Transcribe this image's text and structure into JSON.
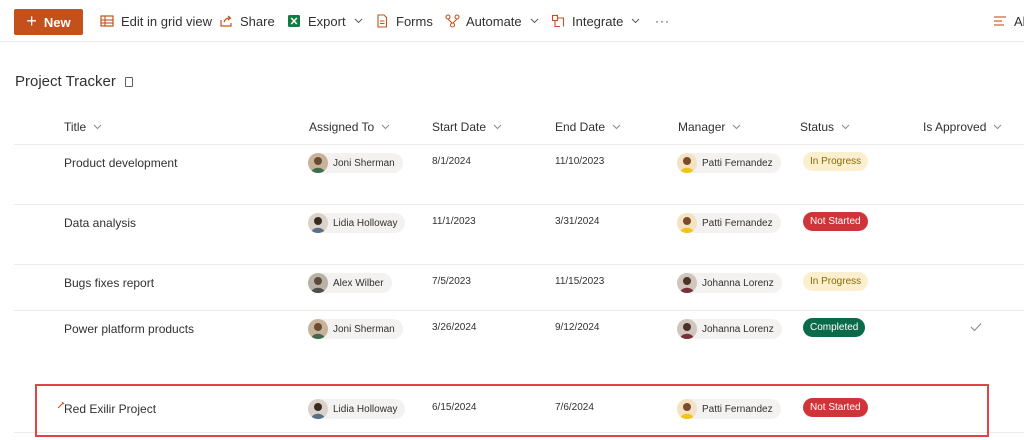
{
  "toolbar": {
    "new_label": "New",
    "edit_grid_label": "Edit in grid view",
    "share_label": "Share",
    "export_label": "Export",
    "forms_label": "Forms",
    "automate_label": "Automate",
    "integrate_label": "Integrate",
    "more_label": "···",
    "view_label": "Al",
    "accent_color": "#c4501b",
    "icons": [
      "plus-icon",
      "grid-icon",
      "share-icon",
      "excel-icon",
      "forms-icon",
      "automate-icon",
      "integrate-icon",
      "more-icon",
      "filter-lines-icon"
    ]
  },
  "list": {
    "title": "Project Tracker",
    "columns": [
      "Title",
      "Assigned To",
      "Start Date",
      "End Date",
      "Manager",
      "Status",
      "Is Approved"
    ],
    "rows": [
      {
        "title": "Product development",
        "assigned_to": "Joni Sherman",
        "start_date": "8/1/2024",
        "end_date": "11/10/2023",
        "manager": "Patti Fernandez",
        "status": "In Progress",
        "approved": false
      },
      {
        "title": "Data analysis",
        "assigned_to": "Lidia Holloway",
        "start_date": "11/1/2023",
        "end_date": "3/31/2024",
        "manager": "Patti Fernandez",
        "status": "Not Started",
        "approved": false
      },
      {
        "title": "Bugs fixes report",
        "assigned_to": "Alex Wilber",
        "start_date": "7/5/2023",
        "end_date": "11/15/2023",
        "manager": "Johanna Lorenz",
        "status": "In Progress",
        "approved": false
      },
      {
        "title": "Power platform products",
        "assigned_to": "Joni Sherman",
        "start_date": "3/26/2024",
        "end_date": "9/12/2024",
        "manager": "Johanna Lorenz",
        "status": "Completed",
        "approved": true
      },
      {
        "title": "Red Exilir Project",
        "assigned_to": "Lidia Holloway",
        "start_date": "6/15/2024",
        "end_date": "7/6/2024",
        "manager": "Patti Fernandez",
        "status": "Not Started",
        "approved": false
      }
    ]
  },
  "status_colors": {
    "In Progress": "#fcefcf",
    "Not Started": "#d13438",
    "Completed": "#0b6a4a"
  },
  "highlight_color": "#e0434a"
}
